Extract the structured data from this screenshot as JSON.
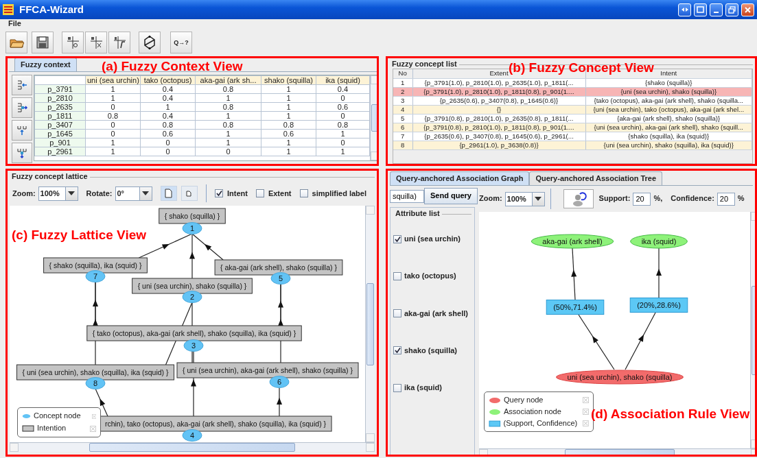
{
  "window": {
    "title": "FFCA-Wizard"
  },
  "menu": [
    "File"
  ],
  "toolbar": {
    "query_button": "Q→?"
  },
  "annotations": [
    "(a) Fuzzy Context View",
    "(b) Fuzzy Concept View",
    "(c) Fuzzy Lattice View",
    "(d) Association Rule View"
  ],
  "context": {
    "tab": {
      "label": "Fuzzy context",
      "selected": true
    },
    "columns": [
      "uni (sea urchin)",
      "tako (octopus)",
      "aka-gai (ark sh...",
      "shako (squilla)",
      "ika (squid)"
    ],
    "rows": [
      {
        "object": "p_3791",
        "values": [
          "1",
          "0.4",
          "0.8",
          "1",
          "0.4"
        ]
      },
      {
        "object": "p_2810",
        "values": [
          "1",
          "0.4",
          "1",
          "1",
          "0"
        ]
      },
      {
        "object": "p_2635",
        "values": [
          "0",
          "1",
          "0.8",
          "1",
          "0.6"
        ]
      },
      {
        "object": "p_1811",
        "values": [
          "0.8",
          "0.4",
          "1",
          "1",
          "0"
        ]
      },
      {
        "object": "p_3407",
        "values": [
          "0",
          "0.8",
          "0.8",
          "0.8",
          "0.8"
        ]
      },
      {
        "object": "p_1645",
        "values": [
          "0",
          "0.6",
          "1",
          "0.6",
          "1"
        ]
      },
      {
        "object": "p_901",
        "values": [
          "1",
          "0",
          "1",
          "1",
          "0"
        ]
      },
      {
        "object": "p_2961",
        "values": [
          "1",
          "0",
          "0",
          "1",
          "1"
        ]
      }
    ]
  },
  "concepts": {
    "title": "Fuzzy concept list",
    "columns": [
      "No",
      "Extent",
      "Intent"
    ],
    "rows": [
      {
        "no": "1",
        "extent": "{p_3791(1.0), p_2810(1.0), p_2635(1.0), p_1811(...",
        "intent": "{shako (squilla)}",
        "selected": false
      },
      {
        "no": "2",
        "extent": "{p_3791(1.0), p_2810(1.0), p_1811(0.8), p_901(1....",
        "intent": "{uni (sea urchin), shako (squilla)}",
        "selected": true
      },
      {
        "no": "3",
        "extent": "{p_2635(0.6), p_3407(0.8), p_1645(0.6)}",
        "intent": "{tako (octopus), aka-gai (ark shell), shako (squilla...",
        "selected": false
      },
      {
        "no": "4",
        "extent": "{}",
        "intent": "{uni (sea urchin), tako (octopus), aka-gai (ark shel...",
        "selected": false
      },
      {
        "no": "5",
        "extent": "{p_3791(0.8), p_2810(1.0), p_2635(0.8), p_1811(...",
        "intent": "{aka-gai (ark shell), shako (squilla)}",
        "selected": false
      },
      {
        "no": "6",
        "extent": "{p_3791(0.8), p_2810(1.0), p_1811(0.8), p_901(1....",
        "intent": "{uni (sea urchin), aka-gai (ark shell), shako (squill...",
        "selected": false
      },
      {
        "no": "7",
        "extent": "{p_2635(0.6), p_3407(0.8), p_1645(0.6), p_2961(...",
        "intent": "{shako (squilla), ika (squid)}",
        "selected": false
      },
      {
        "no": "8",
        "extent": "{p_2961(1.0), p_3638(0.8)}",
        "intent": "{uni (sea urchin), shako (squilla), ika (squid)}",
        "selected": false
      }
    ]
  },
  "lattice": {
    "title": "Fuzzy concept lattice",
    "zoom_label": "Zoom:",
    "zoom": "100%",
    "rotate_label": "Rotate:",
    "rotate": "0°",
    "options": [
      {
        "label": "Intent",
        "checked": true
      },
      {
        "label": "Extent",
        "checked": false
      },
      {
        "label": "simplified label",
        "checked": false
      }
    ],
    "nodes": [
      {
        "id": "1",
        "label": "{ shako (squilla) }"
      },
      {
        "id": "7",
        "label": "{ shako (squilla), ika (squid) }"
      },
      {
        "id": "5",
        "label": "{ aka-gai (ark shell), shako (squilla) }"
      },
      {
        "id": "2",
        "label": "{ uni (sea urchin), shako (squilla) }"
      },
      {
        "id": "3",
        "label": "{ tako (octopus), aka-gai (ark shell), shako (squilla), ika (squid) }"
      },
      {
        "id": "8",
        "label": "{ uni (sea urchin), shako (squilla), ika (squid) }"
      },
      {
        "id": "6",
        "label": "{ uni (sea urchin), aka-gai (ark shell), shako (squilla) }"
      },
      {
        "id": "4",
        "label": "rchin), tako (octopus), aka-gai (ark shell), shako (squilla), ika (squid) }"
      }
    ],
    "legend": [
      {
        "label": "Concept node",
        "kind": "node"
      },
      {
        "label": "Intention",
        "kind": "box"
      }
    ]
  },
  "association": {
    "tabs": [
      {
        "label": "Query-anchored Association Graph",
        "selected": true
      },
      {
        "label": "Query-anchored Association Tree",
        "selected": false
      }
    ],
    "query": "squilla)",
    "send_button": "Send query",
    "attribute_title": "Attribute list",
    "attributes": [
      {
        "label": "uni (sea urchin)",
        "checked": true
      },
      {
        "label": "tako (octopus)",
        "checked": false
      },
      {
        "label": "aka-gai (ark shell)",
        "checked": false
      },
      {
        "label": "shako (squilla)",
        "checked": true
      },
      {
        "label": "ika (squid)",
        "checked": false
      }
    ],
    "zoom_label": "Zoom:",
    "zoom": "100%",
    "support_label": "Support:",
    "support": "20",
    "support_unit": "%,",
    "confidence_label": "Confidence:",
    "confidence": "20",
    "confidence_unit": "%",
    "query_node": "uni (sea urchin), shako (squilla)",
    "rules": [
      {
        "target": "aka-gai (ark shell)",
        "measure": "(50%,71.4%)"
      },
      {
        "target": "ika (squid)",
        "measure": "(20%,28.6%)"
      }
    ],
    "legend": [
      {
        "label": "Query node",
        "kind": "query"
      },
      {
        "label": "Association node",
        "kind": "association"
      },
      {
        "label": "(Support, Confidence)",
        "kind": "measure"
      }
    ]
  }
}
